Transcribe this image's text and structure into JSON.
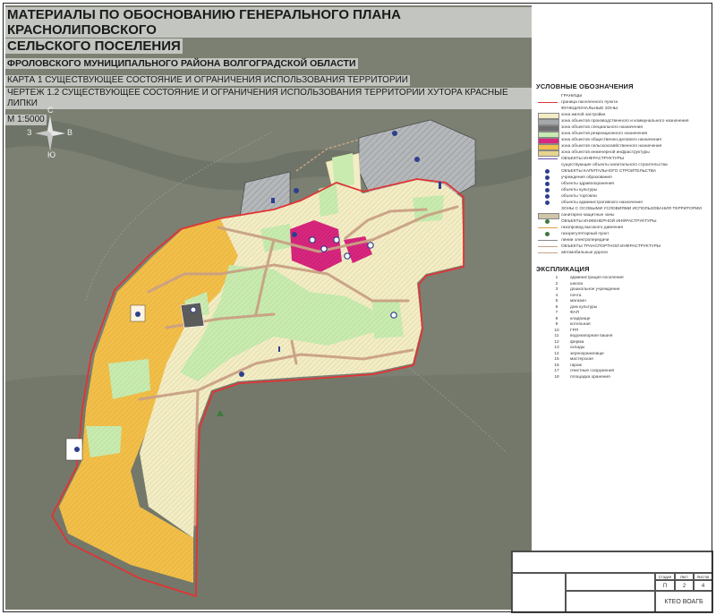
{
  "title": {
    "line1": "МАТЕРИАЛЫ ПО ОБОСНОВАНИЮ ГЕНЕРАЛЬНОГО ПЛАНА КРАСНОЛИПОВСКОГО",
    "line2": "СЕЛЬСКОГО ПОСЕЛЕНИЯ",
    "line3": "ФРОЛОВСКОГО МУНИЦИПАЛЬНОГО РАЙОНА ВОЛГОГРАДСКОЙ ОБЛАСТИ",
    "map_name": "КАРТА 1 СУЩЕСТВУЮЩЕЕ СОСТОЯНИЕ И ОГРАНИЧЕНИЯ ИСПОЛЬЗОВАНИЯ ТЕРРИТОРИИ",
    "sheet_name": "ЧЕРТЕЖ 1.2 СУЩЕСТВУЮЩЕЕ СОСТОЯНИЕ И ОГРАНИЧЕНИЯ ИСПОЛЬЗОВАНИЯ ТЕРРИТОРИИ ХУТОРА КРАСНЫЕ ЛИПКИ",
    "scale": "М 1:5000"
  },
  "compass": {
    "north": "С",
    "south": "Ю",
    "west": "З",
    "east": "В"
  },
  "colors": {
    "satellite": "#7b8073",
    "village_zone": "#f3edc6",
    "hatch": "#d9cf9a",
    "green_zone": "#c9ebb0",
    "agro_zone": "#f1bf4a",
    "industrial_zone": "#a5a8ab",
    "public_zone": "#d9277f",
    "boundary": "#e03434",
    "road": "#c9a184",
    "legend_bg": "#ffffff"
  },
  "legend": {
    "heading": "УСЛОВНЫЕ ОБОЗНАЧЕНИЯ",
    "items": [
      {
        "label": "ГРАНИЦЫ",
        "color": "#ffffff",
        "kind": "text"
      },
      {
        "label": "граница населенного пункта",
        "color": "#e03434",
        "kind": "line"
      },
      {
        "label": "ФУНКЦИОНАЛЬНЫЕ ЗОНЫ",
        "color": "#ffffff",
        "kind": "text"
      },
      {
        "label": "зона жилой застройки",
        "color": "#f3edc6",
        "kind": "fill"
      },
      {
        "label": "зона объектов производственного и коммунального назначения",
        "color": "#a5a8ab",
        "kind": "fill"
      },
      {
        "label": "зона объектов специального назначения",
        "color": "#6e6e6e",
        "kind": "fill"
      },
      {
        "label": "зона объектов рекреационного назначения",
        "color": "#c9ebb0",
        "kind": "fill"
      },
      {
        "label": "зона объектов общественно-делового назначения",
        "color": "#d9277f",
        "kind": "fill"
      },
      {
        "label": "зона объектов сельскохозяйственного назначения",
        "color": "#f1bf4a",
        "kind": "fill"
      },
      {
        "label": "зона объектов инженерной инфраструктуры",
        "color": "#e7d48e",
        "kind": "fill"
      },
      {
        "label": "ОБЪЕКТЫ ИНФРАСТРУКТУРЫ",
        "color": "#6b4aa8",
        "kind": "line"
      },
      {
        "label": "существующие объекты капитального строительства",
        "color": "#ffffff",
        "kind": "text"
      },
      {
        "label": "ОБЪЕКТЫ КАПИТАЛЬНОГО СТРОИТЕЛЬСТВА",
        "color": "#2f3f8f",
        "kind": "icon"
      },
      {
        "label": "учреждения образования",
        "color": "#2f3f8f",
        "kind": "icon"
      },
      {
        "label": "объекты здравоохранения",
        "color": "#2f3f8f",
        "kind": "icon"
      },
      {
        "label": "объекты культуры",
        "color": "#2f3f8f",
        "kind": "icon"
      },
      {
        "label": "объекты торговли",
        "color": "#2f3f8f",
        "kind": "icon"
      },
      {
        "label": "объекты административного назначения",
        "color": "#2f3f8f",
        "kind": "icon"
      },
      {
        "label": "ЗОНЫ С ОСОБЫМИ УСЛОВИЯМИ ИСПОЛЬЗОВАНИЯ ТЕРРИТОРИИ",
        "color": "#ffffff",
        "kind": "text"
      },
      {
        "label": "санитарно-защитные зоны",
        "color": "#cfc6a9",
        "kind": "fill"
      },
      {
        "label": "ОБЪЕКТЫ ИНЖЕНЕРНОЙ ИНФРАСТРУКТУРЫ",
        "color": "#3c7a3c",
        "kind": "icon"
      },
      {
        "label": "газопровод высокого давления",
        "color": "#e0a046",
        "kind": "line"
      },
      {
        "label": "газорегуляторный пункт",
        "color": "#3c7a3c",
        "kind": "icon"
      },
      {
        "label": "линии электропередачи",
        "color": "#8a8a8a",
        "kind": "line"
      },
      {
        "label": "ОБЪЕКТЫ ТРАНСПОРТНОЙ ИНФРАСТРУКТУРЫ",
        "color": "#c9a184",
        "kind": "line"
      },
      {
        "label": "автомобильные дороги",
        "color": "#c9a184",
        "kind": "line"
      }
    ]
  },
  "explication": {
    "heading": "ЭКСПЛИКАЦИЯ",
    "rows": [
      {
        "n": "1",
        "text": "администрация поселения"
      },
      {
        "n": "2",
        "text": "школа"
      },
      {
        "n": "3",
        "text": "дошкольное учреждение"
      },
      {
        "n": "4",
        "text": "почта"
      },
      {
        "n": "5",
        "text": "магазин"
      },
      {
        "n": "6",
        "text": "дом культуры"
      },
      {
        "n": "7",
        "text": "ФАП"
      },
      {
        "n": "8",
        "text": "кладбище"
      },
      {
        "n": "9",
        "text": "котельная"
      },
      {
        "n": "10",
        "text": "ГРП"
      },
      {
        "n": "11",
        "text": "водонапорная башня"
      },
      {
        "n": "12",
        "text": "ферма"
      },
      {
        "n": "13",
        "text": "склады"
      },
      {
        "n": "14",
        "text": "зернохранилище"
      },
      {
        "n": "15",
        "text": "мастерская"
      },
      {
        "n": "16",
        "text": "гараж"
      },
      {
        "n": "17",
        "text": "очистные сооружения"
      },
      {
        "n": "18",
        "text": "площадка хранения"
      }
    ]
  },
  "stamp": {
    "company": "КТЕО ВОАГБ",
    "sheet": "Лист",
    "sheets": "Листов",
    "stage": "Стадия",
    "stage_val": "П",
    "sheet_val": "2",
    "sheets_val": "4"
  }
}
